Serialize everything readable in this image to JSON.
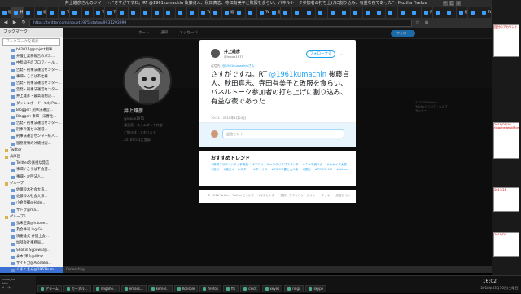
{
  "window": {
    "title": "井上雄彦さんのツイート: \"さすがですね。RT @1961kumachin 後藤貞人、秋田真志、寺田有美子と敗服を食らい、パネルトーク参加者の打ち上げに割り込み、有益な夜であった\" - Mozilla Firefox"
  },
  "tabs": [
    "返信",
    "井上雄彦",
    "",
    "返信",
    "",
    "Twitt",
    "",
    "",
    "Twit",
    "Twit",
    "",
    "",
    "",
    "",
    "",
    "",
    "",
    "Twit",
    "",
    "返信",
    "",
    "",
    "Twit",
    "返信",
    "",
    "",
    "",
    "",
    "",
    "",
    "",
    "",
    "",
    "",
    "",
    "",
    "(Privat",
    "",
    "",
    "返信",
    "",
    "Twit"
  ],
  "address_bar": {
    "url": "https://twitter.com/inouet1975/status/9931293999"
  },
  "sidebar": {
    "title": "ブックマーク",
    "search_placeholder": "ブックマークを検索",
    "items": [
      {
        "label": "bb2017@project用事...",
        "folder": false
      },
      {
        "label": "弁護士業務報告のパス...",
        "folder": false
      },
      {
        "label": "中島知子のプロフィール...",
        "folder": false
      },
      {
        "label": "告発・刑事法運営センター...",
        "folder": false
      },
      {
        "label": "事細・こうは不仕様...",
        "folder": false
      },
      {
        "label": "告発・刑事法運営センター...",
        "folder": false
      },
      {
        "label": "告発・刑事法運営センター...",
        "folder": false
      },
      {
        "label": "井上雄彦・最高裁判決...",
        "folder": false
      },
      {
        "label": "ダッシュボード・tidy.Pro...",
        "folder": false
      },
      {
        "label": "Blogger: 刑事法運営...",
        "folder": false
      },
      {
        "label": "Blogger: 事細・法曹社...",
        "folder": false
      },
      {
        "label": "告発・刑事法運営センター...",
        "folder": false
      },
      {
        "label": "刑事弁護ゼミ運営...",
        "folder": false
      },
      {
        "label": "刑事法運営センター経人...",
        "folder": false
      },
      {
        "label": "服務要領の沖縄付実...",
        "folder": false
      },
      {
        "label": "Twitter",
        "folder": true
      },
      {
        "label": "兵庫区",
        "folder": true
      },
      {
        "label": "Twitterの真視な発信",
        "folder": false
      },
      {
        "label": "事細 / こうは不含選...",
        "folder": false
      },
      {
        "label": "事細・左回法人...",
        "folder": false
      },
      {
        "label": "グループ",
        "folder": true
      },
      {
        "label": "佐藤鈴木社会大系...",
        "folder": false
      },
      {
        "label": "佐藤鈴木社会大系...",
        "folder": false
      },
      {
        "label": "小倉亮輔@Hide...",
        "folder": false
      },
      {
        "label": "サトウ@ma...",
        "folder": false
      },
      {
        "label": "グループ5",
        "folder": true
      },
      {
        "label": "弘末正典@h.tone...",
        "folder": false
      },
      {
        "label": "及合井司 log.Go...",
        "folder": false
      },
      {
        "label": "慎慶雄式 弁護士会...",
        "folder": false
      },
      {
        "label": "加部会社事務局...",
        "folder": false
      },
      {
        "label": "Shokin Sypewal@...",
        "folder": false
      },
      {
        "label": "永本 澤山@Wtat...",
        "folder": false
      },
      {
        "label": "サイト力@Aronaka...",
        "folder": false
      },
      {
        "label": "くまくさん@1961kum...",
        "folder": false,
        "selected": true
      },
      {
        "label": "木庭上ぼうさん...",
        "folder": false
      },
      {
        "label": "井上雄彦@ohm...",
        "folder": false
      }
    ]
  },
  "twitter": {
    "nav": [
      "ホーム",
      "通知",
      "メッセージ"
    ],
    "follow_top": "フォロー",
    "profile": {
      "name": "井上雄彦",
      "handle": "@inoue1975",
      "lines": [
        "漫画家・スラムダンク作者",
        "ご無沙汰しております",
        "2010年5月に登録"
      ]
    },
    "side_text": "© 2018 Twitter · Twitterについて · ヘルプセンター",
    "tweet": {
      "author": "井上雄彦",
      "handle": "@inoue1975",
      "follow_label": "フォローする",
      "more": "⌄",
      "reply_prefix": "返信先:",
      "reply_to": "@1961kumachinさん",
      "text_before": "さすがですね。RT ",
      "mention": "@1961kumachin",
      "text_after": " 後藤貞人、秋田真志、寺田有美子と敗服を食らい、パネルトーク参加者の打ち上げに割り込み、有益な夜であった",
      "time": "10:31 - 2018年4月24日",
      "reply_placeholder": "返信をツイート"
    },
    "trends": {
      "title": "おすすめトレンド",
      "items": [
        "#新潟フラテンシティ不実施",
        "#ホワイトデーのクリスマスサンタ",
        "#エケ中央スタ",
        "#カオイギ大賞",
        "#佐川",
        "#楽天オールスター",
        "#タナリユ",
        "#TOKYO春と大人な",
        "#国石",
        "#TOKYO ME",
        "#Yahoo"
      ]
    },
    "footer": "© 2018 Twitter　Twitterについて　ヘルプセンター　規約　プライバシーポリシー　クッキー　広告について",
    "status": "Connecting..."
  },
  "right_panel": {
    "windows": [
      "自分のアカウント",
      "2018/01/10",
      "ringahegenb@gmail.e",
      "2011/18",
      "2018/00"
    ]
  },
  "taskbar": {
    "left_lines": [
      "Inoue_ex",
      "iktio",
      "メール"
    ],
    "items": [
      "アラーム",
      "カーネル...",
      "ringahe...",
      "emacs...",
      "kernel...",
      "Konsole",
      "firefox",
      "ftk",
      "clock",
      "xeyes",
      "ringa",
      "skype"
    ],
    "clock": "16:02",
    "date": "2018年03月10日(土曜日)"
  },
  "colors": {
    "twitter_blue": "#1da1f2",
    "selected": "#3b6fd1"
  }
}
